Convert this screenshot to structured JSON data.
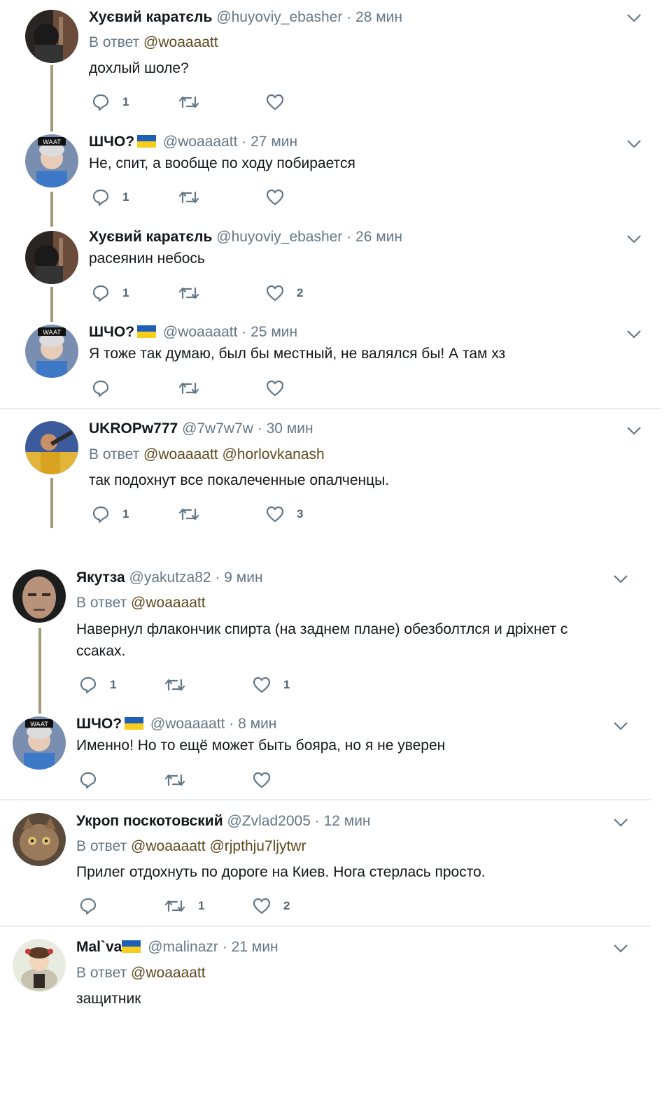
{
  "tweets": [
    {
      "name": "Хуєвий каратєль",
      "handle": "@huyoviy_ebasher",
      "dot": "·",
      "time": "28 мин",
      "reply_label": "В ответ",
      "mentions": [
        "@woaaaatt"
      ],
      "text": "дохлый шоле?",
      "replies": "1",
      "retweets": "",
      "likes": ""
    },
    {
      "name": "ШЧО?",
      "flag": true,
      "handle": "@woaaaatt",
      "dot": "·",
      "time": "27 мин",
      "text": "Не, спит, а вообще по ходу побирается",
      "replies": "1",
      "retweets": "",
      "likes": ""
    },
    {
      "name": "Хуєвий каратєль",
      "handle": "@huyoviy_ebasher",
      "dot": "·",
      "time": "26 мин",
      "text": "расеянин небось",
      "replies": "1",
      "retweets": "",
      "likes": "2"
    },
    {
      "name": "ШЧО?",
      "flag": true,
      "handle": "@woaaaatt",
      "dot": "·",
      "time": "25 мин",
      "text": "Я тоже так думаю, был бы местный, не валялся бы! А там хз",
      "replies": "",
      "retweets": "",
      "likes": ""
    },
    {
      "name": "UKROPw777",
      "handle": "@7w7w7w",
      "dot": "·",
      "time": "30 мин",
      "reply_label": "В ответ",
      "mentions": [
        "@woaaaatt",
        "@horlovkanash"
      ],
      "text": "так подохнут все покалеченные опалченцы.",
      "replies": "1",
      "retweets": "",
      "likes": "3"
    },
    {
      "name": "Якутза",
      "handle": "@yakutza82",
      "dot": "·",
      "time": "9 мин",
      "reply_label": "В ответ",
      "mentions": [
        "@woaaaatt"
      ],
      "text": "Навернул флакончик спирта (на заднем плане) обезболтлся и дріхнет с ссаках.",
      "replies": "1",
      "retweets": "",
      "likes": "1"
    },
    {
      "name": "ШЧО?",
      "flag": true,
      "handle": "@woaaaatt",
      "dot": "·",
      "time": "8 мин",
      "text": "Именно! Но то ещё может быть бояра, но я не уверен",
      "replies": "",
      "retweets": "",
      "likes": ""
    },
    {
      "name": "Укроп поскотовский",
      "handle": "@Zvlad2005",
      "dot": "·",
      "time": "12 мин",
      "reply_label": "В ответ",
      "mentions": [
        "@woaaaatt",
        "@rjpthju7ljytwr"
      ],
      "text": "Прилег отдохнуть по дороге на Киев. Нога стерлась просто.",
      "replies": "",
      "retweets": "1",
      "likes": "2"
    },
    {
      "name": "Mal`va",
      "flag": true,
      "handle": "@malinazr",
      "dot": "·",
      "time": "21 мин",
      "reply_label": "В ответ",
      "mentions": [
        "@woaaaatt"
      ],
      "text": "защитник",
      "replies": "",
      "retweets": "",
      "likes": ""
    }
  ],
  "icons": {
    "reply": "reply-icon",
    "retweet": "retweet-icon",
    "like": "heart-icon",
    "more": "chevron-down-icon",
    "flag": "ukraine-flag-icon"
  },
  "colors": {
    "accent": "#5b4a1e",
    "thread_line": "#a39a7c",
    "muted": "#657786",
    "flag_blue": "#1f5fb8",
    "flag_yellow": "#f7ce1c"
  }
}
